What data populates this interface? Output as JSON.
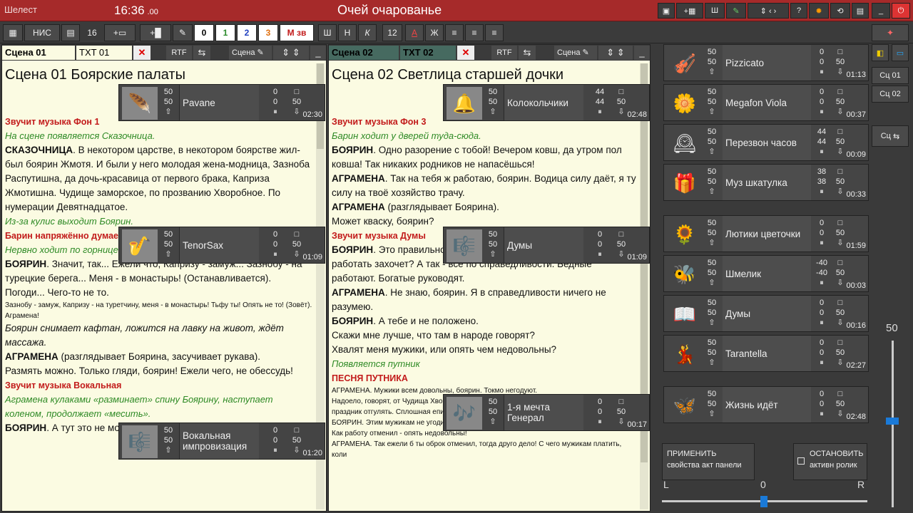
{
  "app": {
    "name": "Шелест",
    "clock": "16:36",
    "clock_frac": ".00",
    "title": "Очей очарованье"
  },
  "toolbar": {
    "nis": "НИС",
    "num": "16",
    "colors": [
      "0",
      "1",
      "2",
      "3",
      "М зв"
    ],
    "font_btns": [
      "Ш",
      "Н",
      "К"
    ],
    "size": "12",
    "align_btns": [
      "А",
      "Ж"
    ],
    "accent": "#a62a2a"
  },
  "left": {
    "tab_scene": "Сцена 01",
    "tab_txt": "TXT 01",
    "rtf": "RTF",
    "scene_btn": "Сцена",
    "heading": "Сцена 01    Боярские палаты",
    "lines": [
      {
        "cls": "red",
        "t": "Звучит музыка Фон 1"
      },
      {
        "cls": "grn",
        "t": "На сцене появляется Сказочница."
      },
      {
        "cls": "",
        "t": " "
      },
      {
        "cls": "p",
        "b": "СКАЗОЧНИЦА",
        "t": ". В некотором царстве, в некотором боярстве жил-был боярин Жмотя. И были у него молодая жена-модница, Зазноба Распутишна, да дочь-красавица от первого брака, Каприза Жмотишна. Чудище заморское, по прозванию Хворобное. По нумерации Девятнадцатое."
      },
      {
        "cls": "",
        "t": " "
      },
      {
        "cls": "grn",
        "t": "Из-за кулис выходит Боярин."
      },
      {
        "cls": "red",
        "t": "Барин напряжённо думает"
      },
      {
        "cls": "grn",
        "t": "Нервно ходит по горнице взад-вперёд. Чем-то сильно озабочен."
      },
      {
        "cls": "",
        "t": " "
      },
      {
        "cls": "p",
        "b": "БОЯРИН",
        "t": ". Значит, так... Ежели что, Капризу - замуж... Зазнобу - на турецкие берега... Меня - в монастырь! (Останавливается). Погоди... Чего-то не то. "
      },
      {
        "cls": "small",
        "t": "Зазнобу - замуж, Капризу - на туретчину, меня - в монастырь! Тьфу ты! Опять не то! (Зовёт). Агрaменa!"
      },
      {
        "cls": "it",
        "t": "Боярин снимает кафтан, ложится на лавку на живот, ждёт массажа."
      },
      {
        "cls": "",
        "t": " "
      },
      {
        "cls": "p",
        "b": "АГРАМЕНА",
        "t": " (разглядывает Боярина, засучивает рукава)."
      },
      {
        "cls": "",
        "t": "Размять можно. Только гляди, боярин! Ежели чего, не обессудь!"
      },
      {
        "cls": "",
        "t": " "
      },
      {
        "cls": "red",
        "t": "Звучит музыка Вокальная"
      },
      {
        "cls": "grn",
        "t": "Аграмена кулаками «разминает» спину Боярину, наступает коленом, продолжает «месить»."
      },
      {
        "cls": "p",
        "b": "БОЯРИН",
        "t": ". А тут это не моя забота!"
      }
    ],
    "cards": [
      {
        "icon": "feather-icon",
        "glyph": "🪶",
        "vol": "50",
        "vol2": "50",
        "name": "Pavane",
        "n1": "0",
        "n2": "50",
        "time": "02:30"
      },
      {
        "icon": "saxophone-icon",
        "glyph": "🎷",
        "vol": "50",
        "vol2": "50",
        "name": "TenorSax",
        "n1": "0",
        "n2": "50",
        "time": "01:09"
      },
      {
        "icon": "music-notes-icon",
        "glyph": "🎼",
        "vol": "50",
        "vol2": "50",
        "name": "Вокальная импровизация",
        "n1": "0",
        "n2": "50",
        "time": "01:20"
      }
    ]
  },
  "middle": {
    "tab_scene": "Сцена 02",
    "tab_txt": "TXT 02",
    "rtf": "RTF",
    "scene_btn": "Сцена",
    "heading": "Сцена 02    Светлица старшей дочки",
    "lines": [
      {
        "cls": "red",
        "t": "Звучит музыка Фон 3"
      },
      {
        "cls": "grn",
        "t": "Барин ходит у дверей туда-сюда."
      },
      {
        "cls": "",
        "t": " "
      },
      {
        "cls": "p",
        "b": "БОЯРИН",
        "t": ". Одно разорение с тобой! Вечером ковш, да утром пол ковша! Так никаких родников не напасёшься!"
      },
      {
        "cls": "p",
        "b": "АГРАМЕНА",
        "t": ". Так на тебя ж работаю, боярин. Водица силу даёт, я ту силу на твоё хозяйство трачу."
      },
      {
        "cls": "p",
        "b": "АГРАМЕНА",
        "t": " (разглядывает Боярина)."
      },
      {
        "cls": "",
        "t": "Может кваску, боярин?"
      },
      {
        "cls": "",
        "t": " "
      },
      {
        "cls": "red",
        "t": "Звучит музыка Думы"
      },
      {
        "cls": "",
        "t": " "
      },
      {
        "cls": "p",
        "b": "БОЯРИН",
        "t": ". Это правильно. Ежели все богато жить начнут, кто ж работать захочет? А так - всё по справедливости. Бедные работают. Богатые руководят."
      },
      {
        "cls": "p",
        "b": "АГРАМЕНА",
        "t": ". Не знаю, боярин. Я в справедливости ничего не разумею."
      },
      {
        "cls": "p",
        "b": "БОЯРИН",
        "t": ". А тебе и не положено."
      },
      {
        "cls": "",
        "t": "Скажи мне лучше, что там в народе говорят?"
      },
      {
        "cls": "",
        "t": "Хвалят меня мужики, или опять чем недовольны?"
      },
      {
        "cls": "",
        "t": " "
      },
      {
        "cls": "grn",
        "t": "Появляется путник"
      },
      {
        "cls": "red",
        "t": "ПЕСНЯ ПУТНИКА"
      },
      {
        "cls": "",
        "t": " "
      },
      {
        "cls": "small",
        "t": "АГРАМЕНА. Мужики всем довольны, боярин. Токмо негодуют."
      },
      {
        "cls": "small",
        "t": "Надоело, говорят, от Чудища Хворобного по избам прятаться. Ни работу сработать, ни праздник отгулять. Сплошная епидемия. Прежней жизни хотят, в работе и в заботе."
      },
      {
        "cls": "small",
        "t": "БОЯРИН. Этим мужикам не угодишь! Как пахать заставлял, кричали, что угнетатель."
      },
      {
        "cls": "small",
        "t": "Как работу отменил - опять недовольны!"
      },
      {
        "cls": "small",
        "t": "АГРАМЕНА. Так ежели б ты оброк отменил, тогда друго дело! С чего мужикам платить, коли"
      }
    ],
    "cards": [
      {
        "icon": "bell-icon",
        "glyph": "🔔",
        "vol": "50",
        "vol2": "50",
        "name": "Колокольчики",
        "n1": "44",
        "n2": "50",
        "n3": "44",
        "time": "02:48"
      },
      {
        "icon": "music-notes-icon",
        "glyph": "🎼",
        "vol": "50",
        "vol2": "50",
        "name": "Думы",
        "n1": "0",
        "n2": "50",
        "time": "01:09"
      },
      {
        "icon": "flute-icon",
        "glyph": "🎶",
        "vol": "50",
        "vol2": "50",
        "name": "1-я мечта Генерал",
        "n1": "0",
        "n2": "50",
        "time": "00:17"
      }
    ]
  },
  "right": {
    "cards": [
      {
        "icon": "violin-icon",
        "glyph": "🎻",
        "vol": "50",
        "vol2": "50",
        "name": "Pizzicato",
        "n1": "0",
        "n2": "50",
        "time": "01:13"
      },
      {
        "icon": "flower-icon",
        "glyph": "🌼",
        "vol": "50",
        "vol2": "50",
        "name": "Megafon Viola",
        "n1": "0",
        "n2": "50",
        "time": "00:37"
      },
      {
        "icon": "clock-icon",
        "glyph": "🕰",
        "vol": "50",
        "vol2": "50",
        "name": "Перезвон часов",
        "n1": "44",
        "n2": "50",
        "n3": "44",
        "time": "00:09"
      },
      {
        "icon": "music-box-icon",
        "glyph": "🎁",
        "vol": "50",
        "vol2": "50",
        "name": "Муз шкатулка",
        "n1": "38",
        "n2": "50",
        "n3": "38",
        "time": "00:33"
      },
      {
        "icon": "buttercup-icon",
        "glyph": "🌻",
        "vol": "50",
        "vol2": "50",
        "name": "Лютики цветочки",
        "n1": "0",
        "n2": "50",
        "time": "01:59"
      },
      {
        "icon": "bumblebee-icon",
        "glyph": "🐝",
        "vol": "50",
        "vol2": "50",
        "name": "Шмелик",
        "n1": "-40",
        "n2": "50",
        "n3": "-40",
        "time": "00:03"
      },
      {
        "icon": "book-icon",
        "glyph": "📖",
        "vol": "50",
        "vol2": "50",
        "name": "Думы",
        "n1": "0",
        "n2": "50",
        "time": "00:16"
      },
      {
        "icon": "dancer-icon",
        "glyph": "💃",
        "vol": "50",
        "vol2": "50",
        "name": "Tarantella",
        "n1": "0",
        "n2": "50",
        "time": "02:27"
      },
      {
        "icon": "butterfly-icon",
        "glyph": "🦋",
        "vol": "50",
        "vol2": "50",
        "name": "Жизнь идёт",
        "n1": "0",
        "n2": "50",
        "time": "02:48"
      }
    ],
    "apply_btn": "ПРИМЕНИТЬ свойства акт панели",
    "stop_btn": "ОСТАНОВИТЬ активн ролик",
    "pan_l": "L",
    "pan_c": "0",
    "pan_r": "R",
    "master": "50",
    "sc01": "Сц 01",
    "sc02": "Сц 02",
    "sc": "Сц"
  }
}
